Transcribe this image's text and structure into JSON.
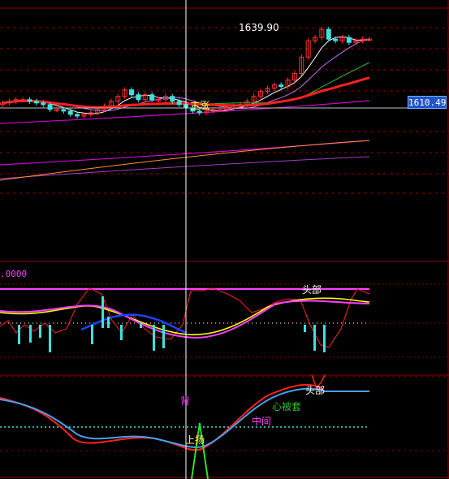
{
  "colors": {
    "background": "#000000",
    "grid": "#8b0000",
    "crosshair": "#ffffff",
    "up_candle": "#ff3030",
    "down_candle": "#40e0e0",
    "ma_white": "#ffffff",
    "ma_yellow": "#ffff00",
    "ma_green": "#30c030",
    "ma_red": "#ff2020",
    "ma_violet": "#d070f0",
    "ma_magenta": "#d000d0",
    "ma_orange": "#ff9030",
    "ma_purple_long": "#a040c0",
    "band_magenta": "#ff40ff",
    "blue_line": "#2040ff",
    "dot_line": "#40e0e0"
  },
  "price_panel": {
    "high_label": "1639.90",
    "current_price": "1610.49",
    "annotation": "主涨"
  },
  "osc_panel": {
    "level_label": ".0000",
    "annotation": "头部"
  },
  "bottom_panel": {
    "label_head": "头部",
    "label_trapped": "心被套",
    "label_mid": "中间",
    "label_back": "背",
    "label_up": "上扬"
  },
  "chart_data": {
    "type": "candlestick",
    "panels": 3,
    "bars": 55,
    "closes": [
      1592,
      1593,
      1594,
      1594,
      1593,
      1592,
      1591,
      1588,
      1588,
      1587,
      1585,
      1584,
      1585,
      1586,
      1588,
      1590,
      1593,
      1596,
      1600,
      1597,
      1594,
      1597,
      1594,
      1594,
      1596,
      1593,
      1591,
      1589,
      1587,
      1586,
      1587,
      1588,
      1588,
      1589,
      1590,
      1591,
      1593,
      1596,
      1599,
      1601,
      1603,
      1602,
      1606,
      1610,
      1620,
      1630,
      1632,
      1637,
      1631,
      1630,
      1632,
      1629,
      1630,
      1631,
      1631
    ],
    "high_marker": 1639.9,
    "last_price": 1610.49
  }
}
